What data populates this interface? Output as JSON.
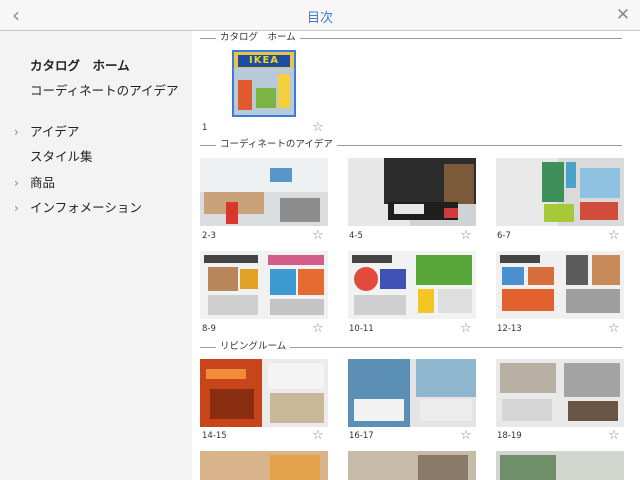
{
  "topbar": {
    "back_icon": "‹",
    "title": "目次",
    "close_icon": "✕"
  },
  "sidebar": {
    "items": [
      {
        "label": "カタログ　ホーム",
        "chevron": ""
      },
      {
        "label": "コーディネートのアイデア",
        "chevron": ""
      },
      {
        "label": "アイデア",
        "chevron": "›"
      },
      {
        "label": "スタイル集",
        "chevron": ""
      },
      {
        "label": "商品",
        "chevron": "›"
      },
      {
        "label": "インフォメーション",
        "chevron": "›"
      }
    ]
  },
  "sections": [
    {
      "title": "カタログ　ホーム"
    },
    {
      "title": "コーディネートのアイデア"
    },
    {
      "title": "リビングルーム"
    }
  ],
  "cover": {
    "logo_text": "IKEA",
    "page": "1"
  },
  "pages": [
    {
      "label": "2-3"
    },
    {
      "label": "4-5"
    },
    {
      "label": "6-7"
    },
    {
      "label": "8-9"
    },
    {
      "label": "10-11"
    },
    {
      "label": "12-13"
    },
    {
      "label": "14-15"
    },
    {
      "label": "16-17"
    },
    {
      "label": "18-19"
    }
  ],
  "star_icon": "☆",
  "colors": {
    "accent": "#3a7bd5",
    "sidebar_bg": "#f3f3f3",
    "ikea_blue": "#1b4ea3",
    "ikea_yellow": "#f2d21a"
  }
}
